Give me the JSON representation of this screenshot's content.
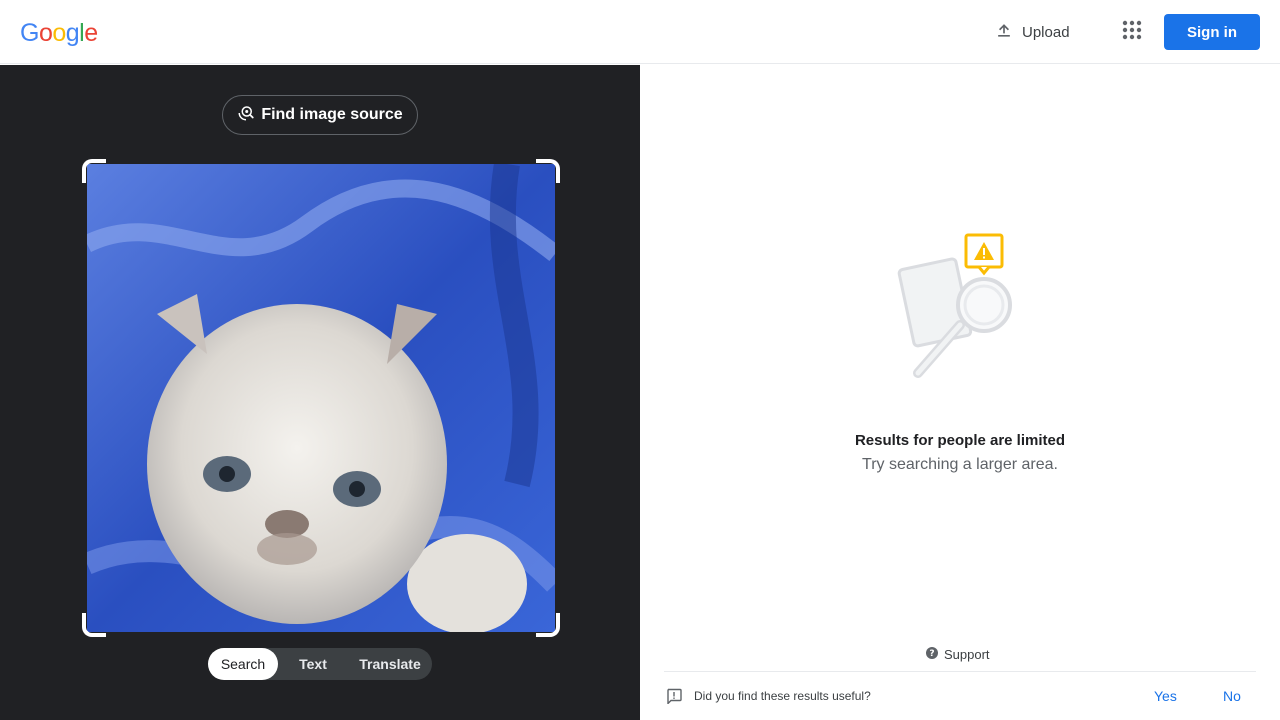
{
  "header": {
    "logo_letters": [
      {
        "char": "G",
        "color": "#4285F4"
      },
      {
        "char": "o",
        "color": "#EA4335"
      },
      {
        "char": "o",
        "color": "#FBBC05"
      },
      {
        "char": "g",
        "color": "#4285F4"
      },
      {
        "char": "l",
        "color": "#34A853"
      },
      {
        "char": "e",
        "color": "#EA4335"
      }
    ],
    "upload_label": "Upload",
    "upload_icon": "upload-icon",
    "apps_icon": "apps-grid-icon",
    "signin_label": "Sign in",
    "accent_color": "#1a73e8"
  },
  "left_panel": {
    "find_source_label": "Find image source",
    "find_source_icon": "image-search-icon",
    "image_subject": "white kitten on blue fabric",
    "mode_tabs": [
      {
        "label": "Search",
        "active": true
      },
      {
        "label": "Text",
        "active": false
      },
      {
        "label": "Translate",
        "active": false
      }
    ]
  },
  "right_panel": {
    "empty_title": "Results for people are limited",
    "empty_subtitle": "Try searching a larger area.",
    "support_label": "Support",
    "feedback_question": "Did you find these results useful?",
    "feedback_yes": "Yes",
    "feedback_no": "No"
  }
}
